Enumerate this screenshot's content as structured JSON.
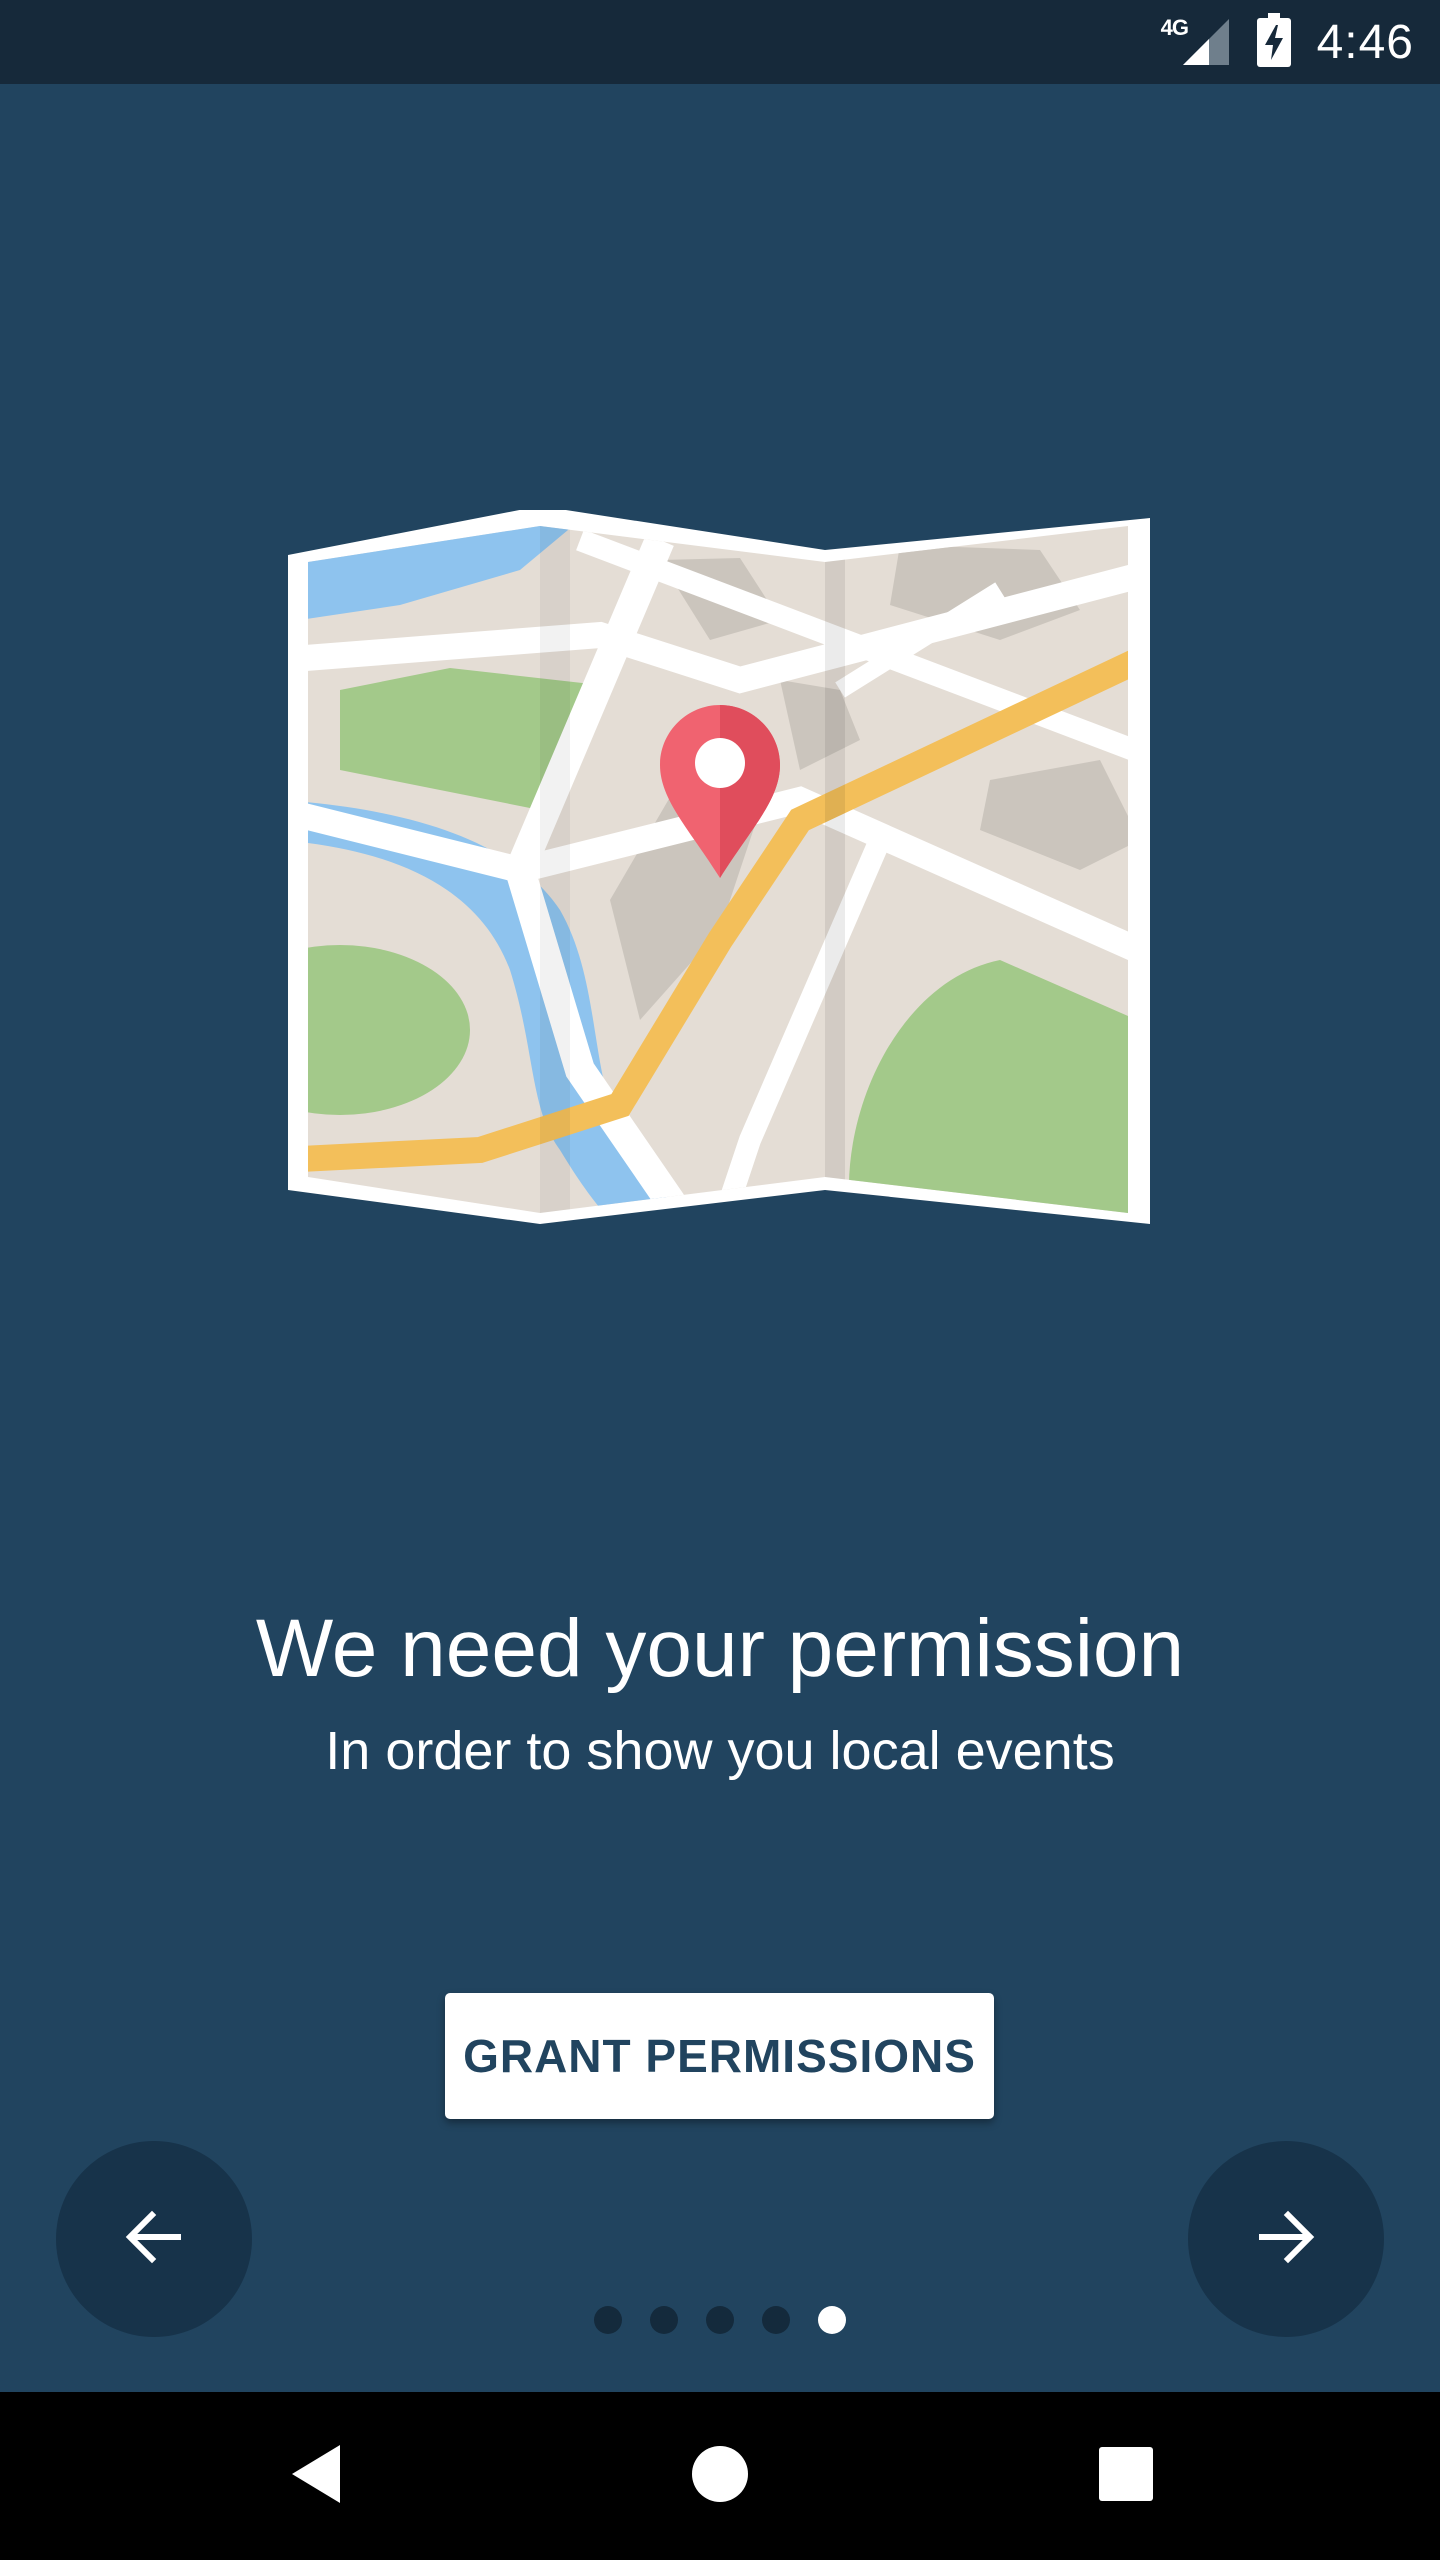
{
  "status_bar": {
    "network_label": "4G",
    "time": "4:46",
    "icons": [
      "signal-icon",
      "battery-charging-icon"
    ]
  },
  "illustration": {
    "name": "folded-map-illustration",
    "pin": "location-pin-icon"
  },
  "content": {
    "title": "We need your permission",
    "subtitle": "In order to show you local events"
  },
  "actions": {
    "grant_label": "GRANT PERMISSIONS"
  },
  "navigation": {
    "prev_icon": "arrow-left-icon",
    "next_icon": "arrow-right-icon",
    "page_count": 5,
    "current_page": 5
  },
  "system_nav": {
    "icons": [
      "back-icon",
      "home-icon",
      "recents-icon"
    ]
  },
  "colors": {
    "background": "#21445f",
    "status_bar": "#16293a",
    "nav_circle": "#17334a",
    "dot_inactive": "#142a3c",
    "dot_active": "#ffffff",
    "pin": "#f06370",
    "road_route": "#f3bf5a",
    "park": "#a3c98a",
    "water": "#8ec3ee"
  }
}
